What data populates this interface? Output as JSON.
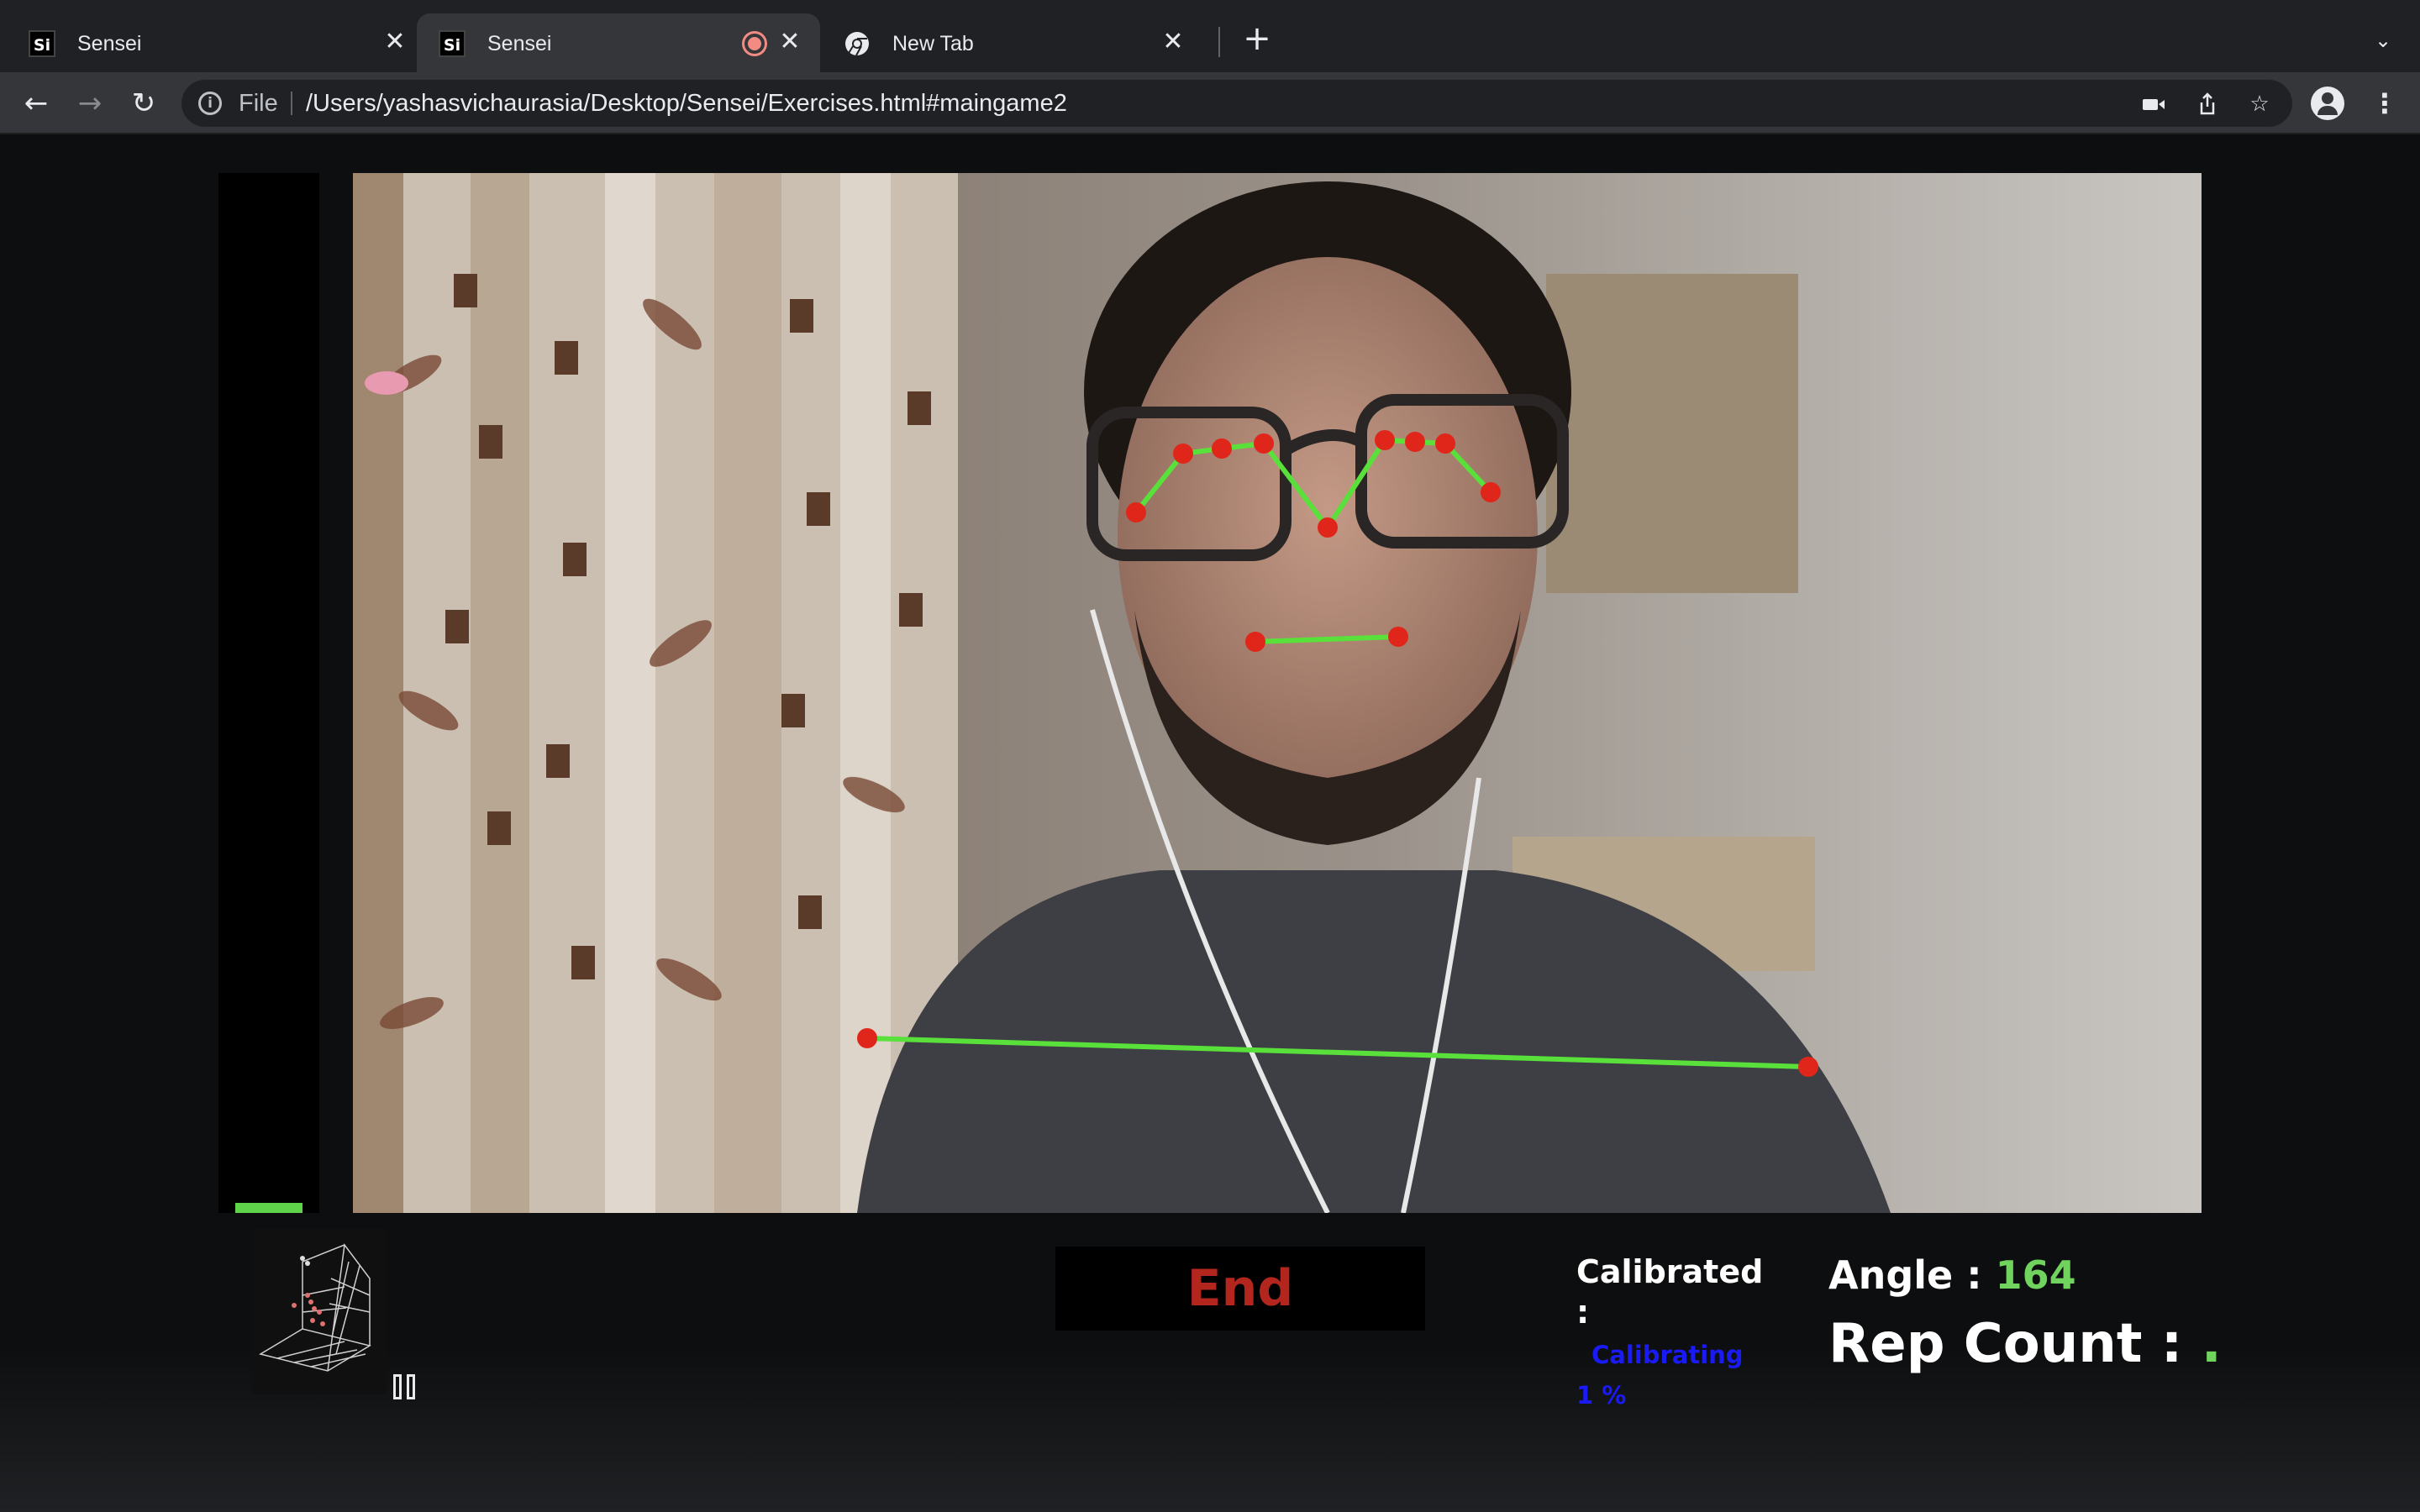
{
  "browser": {
    "tabs": [
      {
        "title": "Sensei",
        "favicon": "Si"
      },
      {
        "title": "Sensei",
        "favicon": "Si",
        "recording": true
      },
      {
        "title": "New Tab",
        "favicon": "chrome-icon"
      }
    ],
    "address": {
      "scheme_label": "File",
      "url": "/Users/yashasvichaurasia/Desktop/Sensei/Exercises.html#maingame2"
    }
  },
  "app": {
    "end_label": "End",
    "calibrated_label": "Calibrated :",
    "calibration_status": "Calibrating",
    "calibration_percent": "1 %",
    "angle_label": "Angle : ",
    "angle_value": "164",
    "rep_label": "Rep Count : ",
    "rep_value": ".",
    "colors": {
      "accent_green": "#70d35e",
      "end_red": "#b3261e",
      "calibrating_blue": "#1a1af5",
      "keypoint_red": "#e0261a"
    }
  }
}
